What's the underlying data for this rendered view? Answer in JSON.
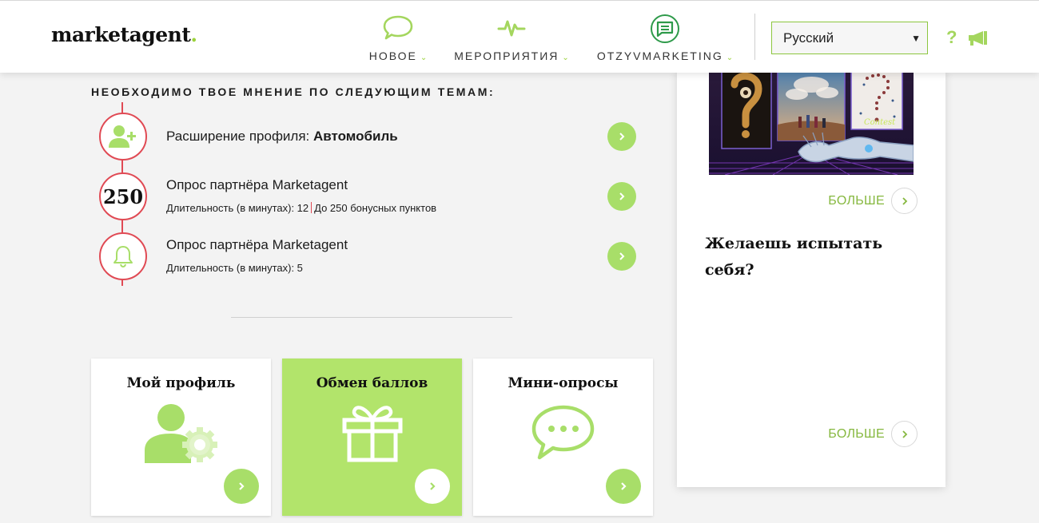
{
  "header": {
    "logo_text": "marketagent",
    "logo_dot": ".",
    "nav": [
      {
        "label": "НОВОЕ",
        "icon": "speech-bubble-icon"
      },
      {
        "label": "МЕРОПРИЯТИЯ",
        "icon": "pulse-icon"
      },
      {
        "label": "OTZYVMARKETING",
        "icon": "chat-lines-icon"
      }
    ],
    "language_selected": "Русский",
    "help_label": "?",
    "accent_color": "#a4d65e"
  },
  "topics": {
    "heading": "НЕОБХОДИМО ТВОЕ МНЕНИЕ ПО СЛЕДУЮЩИМ ТЕМАМ:",
    "items": [
      {
        "icon": "add-user-icon",
        "title_prefix": "Расширение профиля: ",
        "title_bold": "Автомобиль",
        "sub": "",
        "sub_extra": ""
      },
      {
        "badge": "250",
        "title_prefix": "Опрос партнёра Marketagent",
        "title_bold": "",
        "sub": "Длительность (в минутах): 12",
        "sub_extra": "До 250 бонусных пунктов"
      },
      {
        "icon": "bell-icon",
        "title_prefix": "Опрос партнёра Marketagent",
        "title_bold": "",
        "sub": "Длительность (в минутах): 5",
        "sub_extra": ""
      }
    ]
  },
  "cards": [
    {
      "title": "Мой профиль",
      "icon": "user-settings-icon"
    },
    {
      "title": "Обмен баллов",
      "icon": "gift-icon"
    },
    {
      "title": "Мини-опросы",
      "icon": "chat-dots-icon"
    }
  ],
  "panel": {
    "more_label_1": "БОЛЬШЕ",
    "heading": "Желаешь испытать себя?",
    "more_label_2": "БОЛЬШЕ"
  },
  "colors": {
    "brand_green": "#a8de69",
    "accent_red": "#e04a54",
    "card_green": "#b2e46b"
  }
}
